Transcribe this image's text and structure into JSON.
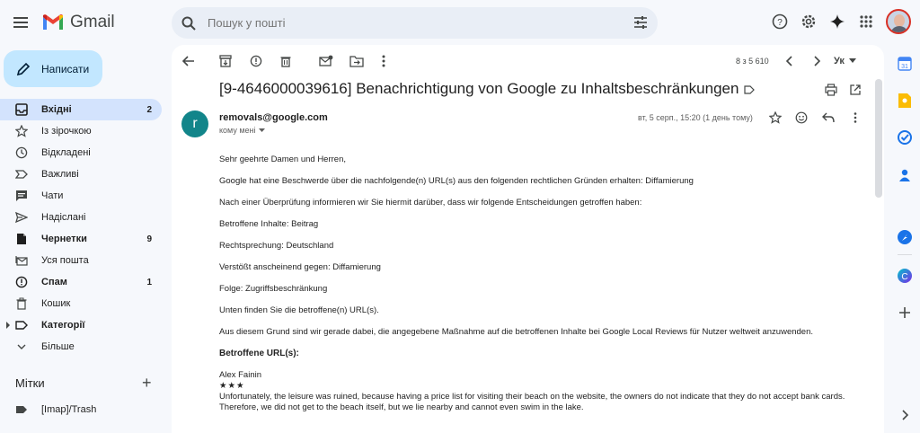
{
  "app": {
    "name": "Gmail"
  },
  "search": {
    "placeholder": "Пошук у пошті"
  },
  "compose": {
    "label": "Написати"
  },
  "nav": [
    {
      "label": "Вхідні",
      "count": "2",
      "icon": "inbox-icon",
      "bold": true,
      "active": true
    },
    {
      "label": "Із зірочкою",
      "count": "",
      "icon": "star-icon"
    },
    {
      "label": "Відкладені",
      "count": "",
      "icon": "clock-icon"
    },
    {
      "label": "Важливі",
      "count": "",
      "icon": "important-icon"
    },
    {
      "label": "Чати",
      "count": "",
      "icon": "chat-icon"
    },
    {
      "label": "Надіслані",
      "count": "",
      "icon": "send-icon"
    },
    {
      "label": "Чернетки",
      "count": "9",
      "icon": "draft-icon",
      "bold": true
    },
    {
      "label": "Уся пошта",
      "count": "",
      "icon": "all-mail-icon"
    },
    {
      "label": "Спам",
      "count": "1",
      "icon": "spam-icon",
      "bold": true
    },
    {
      "label": "Кошик",
      "count": "",
      "icon": "trash-icon"
    },
    {
      "label": "Категорії",
      "count": "",
      "icon": "label-icon",
      "bold": true
    },
    {
      "label": "Більше",
      "count": "",
      "icon": "chevron-down-icon"
    }
  ],
  "labels": {
    "title": "Мітки",
    "items": [
      {
        "label": "[Imap]/Trash"
      }
    ]
  },
  "toolbar": {
    "pager": "8 з 5 610",
    "lang": "Ук"
  },
  "email": {
    "subject": "[9-4646000039616] Benachrichtigung von Google zu Inhaltsbeschränkungen",
    "avatar_letter": "r",
    "sender": "removals@google.com",
    "to": "кому мені",
    "date": "вт, 5 серп., 15:20 (1 день тому)",
    "body": [
      "Sehr geehrte Damen und Herren,",
      "Google hat eine Beschwerde über die nachfolgende(n) URL(s) aus den folgenden rechtlichen Gründen erhalten: Diffamierung",
      "Nach einer Überprüfung informieren wir Sie hiermit darüber, dass wir folgende Entscheidungen getroffen haben:",
      "Betroffene Inhalte: Beitrag",
      "Rechtsprechung: Deutschland",
      "Verstößt anscheinend gegen: Diffamierung",
      "Folge: Zugriffsbeschränkung",
      "Unten finden Sie die betroffene(n) URL(s).",
      "Aus diesem Grund sind wir gerade dabei, die angegebene Maßnahme auf die betroffenen Inhalte bei Google Local Reviews für Nutzer weltweit anzuwenden."
    ],
    "urls_heading": "Betroffene URL(s):",
    "review_author": "Alex Fainin",
    "review_stars": "★★★",
    "review_text": "Unfortunately, the leisure was ruined, because having a price list for visiting their beach on the website, the owners do not indicate that they do not accept bank cards. Therefore, we did not get to the beach itself, but we lie nearby and cannot even swim in the lake."
  },
  "colors": {
    "accent": "#0b57d0",
    "active_bg": "#d3e3fd",
    "compose_bg": "#c2e7ff",
    "avatar_bg": "#12858a"
  }
}
